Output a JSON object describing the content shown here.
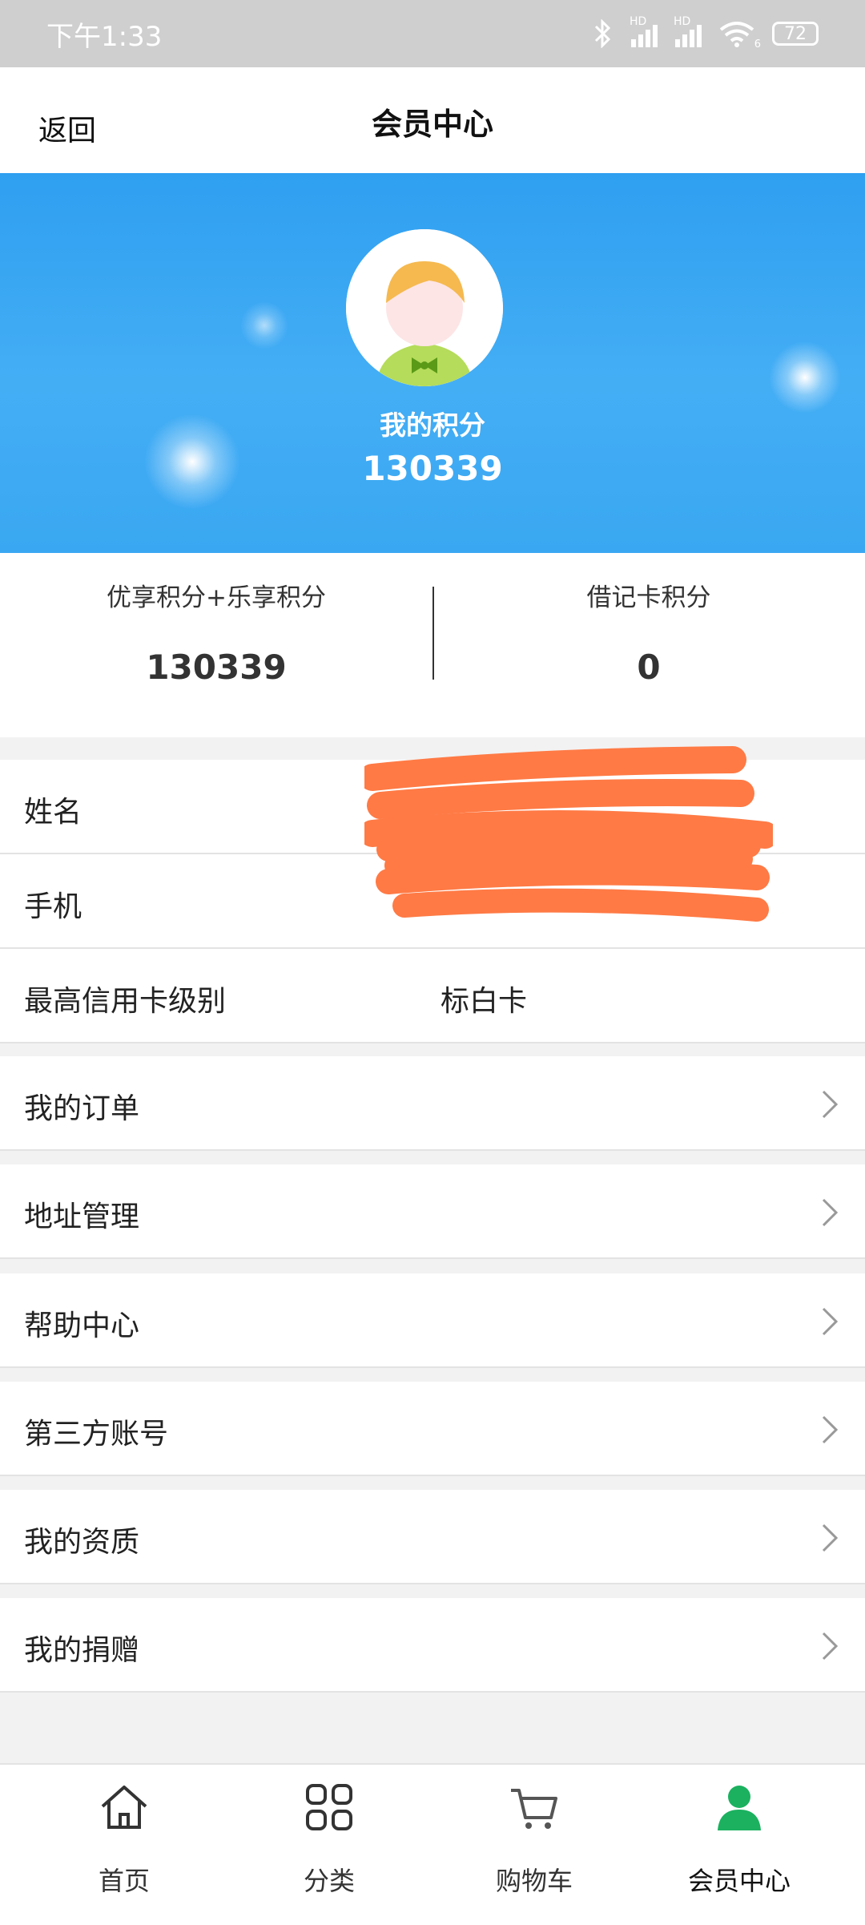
{
  "status_bar": {
    "time": "下午1:33",
    "network_badges": [
      "HD",
      "HD"
    ],
    "wifi_badge": "6",
    "battery": "72"
  },
  "header": {
    "back_label": "返回",
    "title": "会员中心"
  },
  "hero": {
    "points_label": "我的积分",
    "points_value": "130339"
  },
  "points_summary": {
    "left": {
      "label": "优享积分+乐享积分",
      "value": "130339"
    },
    "right": {
      "label": "借记卡积分",
      "value": "0"
    }
  },
  "profile": {
    "name_label": "姓名",
    "phone_label": "手机",
    "card_level_label": "最高信用卡级别",
    "card_level_value": "标白卡"
  },
  "menu": [
    {
      "label": "我的订单"
    },
    {
      "label": "地址管理"
    },
    {
      "label": "帮助中心"
    },
    {
      "label": "第三方账号"
    },
    {
      "label": "我的资质"
    },
    {
      "label": "我的捐赠"
    }
  ],
  "tabbar": {
    "items": [
      {
        "label": "首页",
        "icon": "home-icon"
      },
      {
        "label": "分类",
        "icon": "grid-icon"
      },
      {
        "label": "购物车",
        "icon": "cart-icon"
      },
      {
        "label": "会员中心",
        "icon": "user-icon"
      }
    ],
    "active_color": "#1bb15f"
  }
}
